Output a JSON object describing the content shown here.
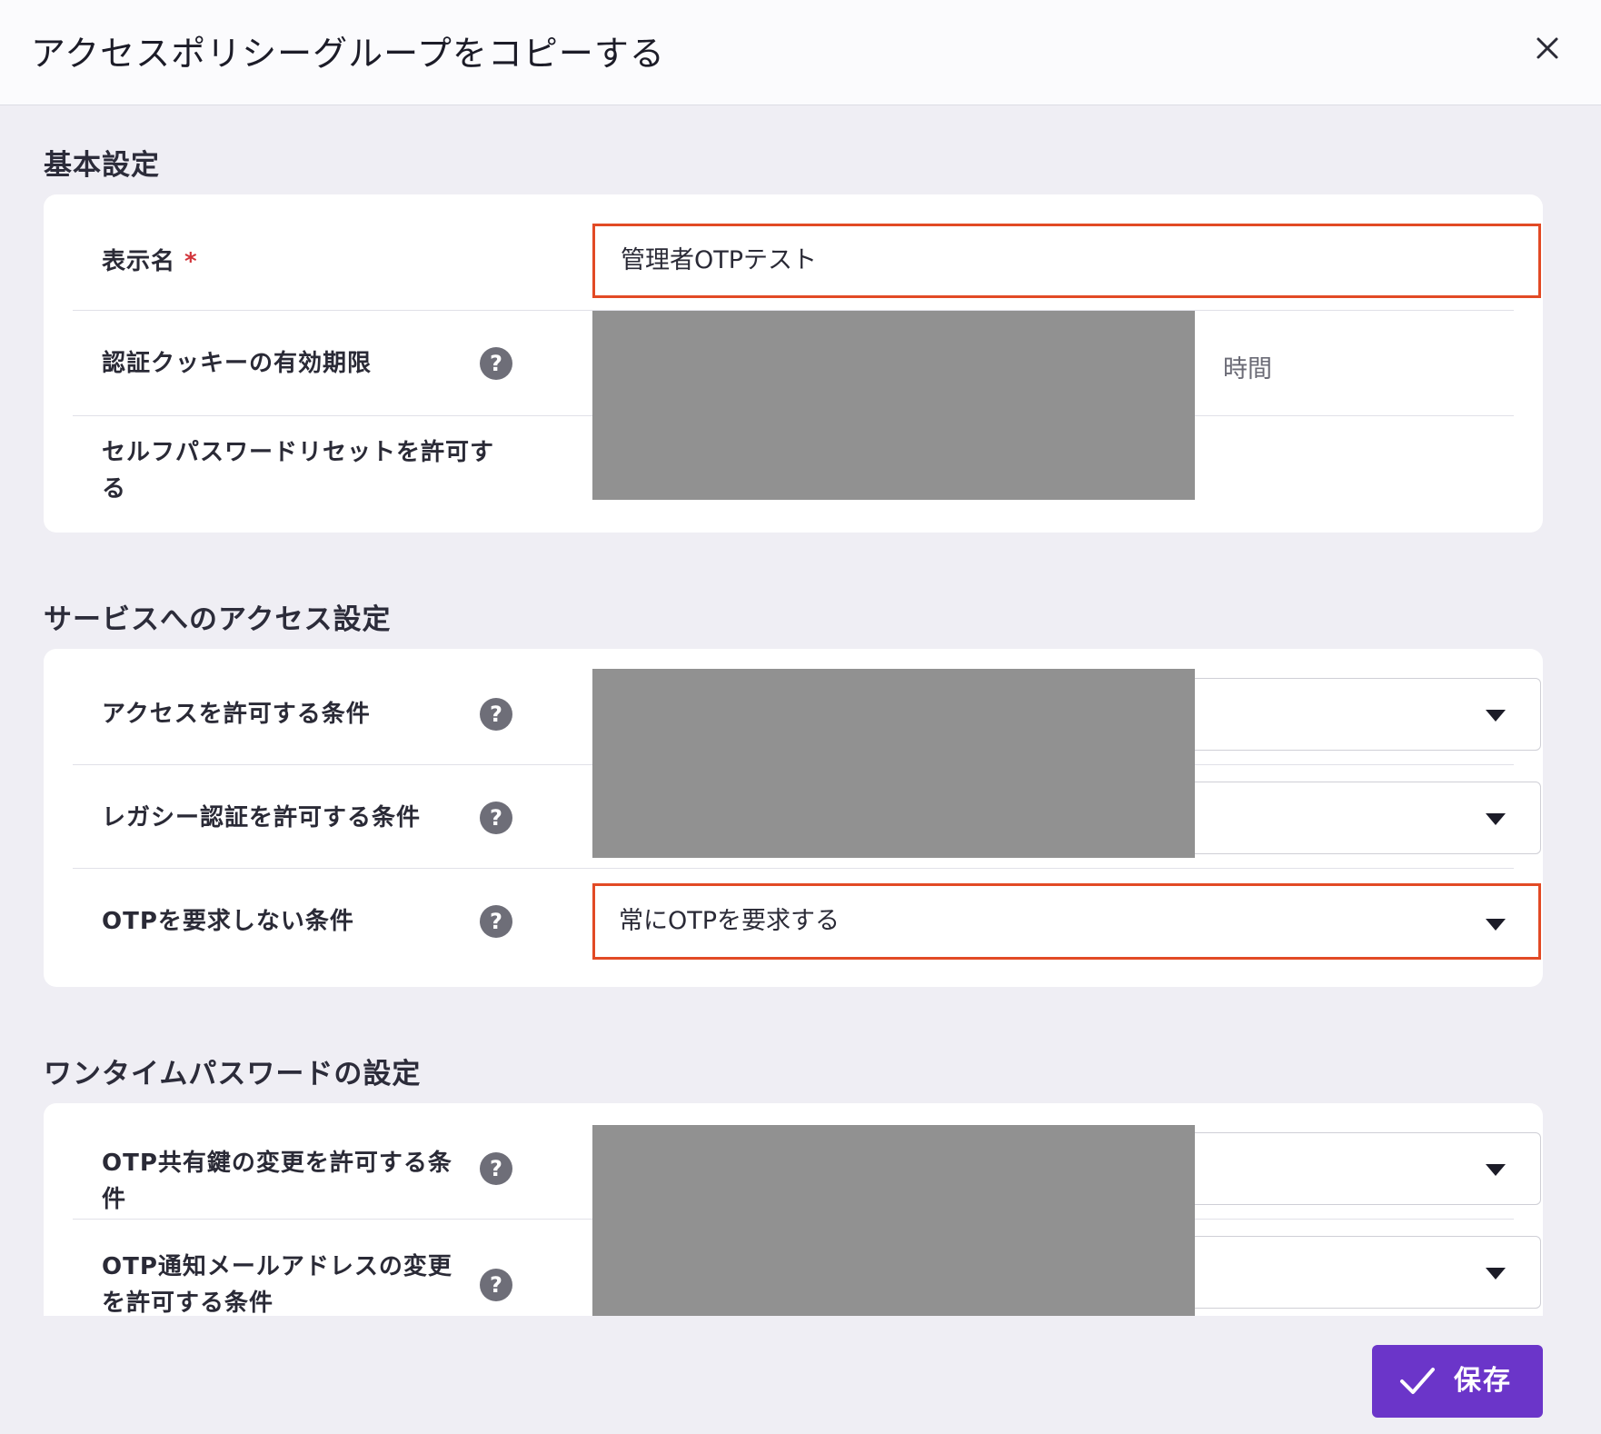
{
  "dialog": {
    "title": "アクセスポリシーグループをコピーする"
  },
  "sections": {
    "basic": {
      "title": "基本設定",
      "display_name_label": "表示名",
      "required_mark": "*",
      "display_name_value": "管理者OTPテスト",
      "cookie_label": "認証クッキーの有効期限",
      "cookie_unit": "時間",
      "self_reset_label": "セルフパスワードリセットを許可する"
    },
    "service_access": {
      "title": "サービスへのアクセス設定",
      "allow_access_label": "アクセスを許可する条件",
      "legacy_auth_label": "レガシー認証を許可する条件",
      "otp_not_required_label": "OTPを要求しない条件",
      "otp_not_required_value": "常にOTPを要求する"
    },
    "otp": {
      "title": "ワンタイムパスワードの設定",
      "shared_key_label": "OTP共有鍵の変更を許可する条件",
      "email_label": "OTP通知メールアドレスの変更を許可する条件"
    }
  },
  "help_symbol": "?",
  "footer": {
    "save_label": "保存"
  },
  "colors": {
    "highlight": "#e24a25",
    "primary_button": "#6b35c9",
    "redaction": "#919191"
  }
}
